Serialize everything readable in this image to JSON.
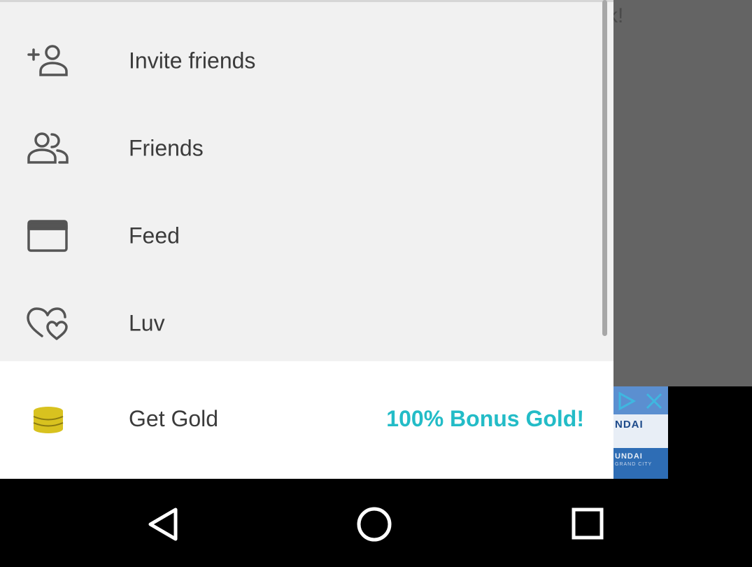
{
  "backdrop": {
    "partial_text": "k!"
  },
  "menu": {
    "items": [
      {
        "label": "Invite friends",
        "icon": "add-person-icon"
      },
      {
        "label": "Friends",
        "icon": "people-icon"
      },
      {
        "label": "Feed",
        "icon": "feed-icon"
      },
      {
        "label": "Luv",
        "icon": "hearts-icon"
      }
    ],
    "gold": {
      "label": "Get Gold",
      "promo": "100% Bonus Gold!",
      "icon": "coins-icon"
    }
  },
  "ad": {
    "text": "NDAI",
    "text2": "UNDAI",
    "text3": "GRAND CITY"
  },
  "navigation": {
    "back": "back-icon",
    "home": "home-icon",
    "recents": "recents-icon"
  },
  "colors": {
    "drawer_bg": "#f1f1f1",
    "gold_row_bg": "#ffffff",
    "promo": "#23bcc7",
    "coin": "#d8c21f",
    "icon": "#555555"
  }
}
